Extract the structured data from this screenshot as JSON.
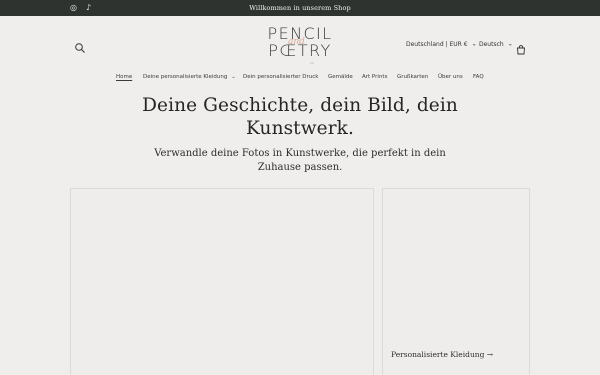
{
  "announcement": {
    "text": "Willkommen in unserem Shop",
    "social": [
      {
        "name": "instagram",
        "glyph": "◎"
      },
      {
        "name": "tiktok",
        "glyph": "♪"
      }
    ]
  },
  "header": {
    "search_icon": "search-icon",
    "logo": {
      "line1": "PENCIL",
      "line2": "PŒTRY",
      "middle": "and",
      "tagline": "co."
    },
    "country_selector": "Deutschland | EUR €",
    "language_selector": "Deutsch",
    "chevron": "⌄",
    "cart_icon": "cart-icon"
  },
  "nav": {
    "items": [
      {
        "label": "Home"
      },
      {
        "label": "Deine personalisierte Kleidung"
      },
      {
        "label": "Dein personalisierter Druck"
      },
      {
        "label": "Gemälde"
      },
      {
        "label": "Art Prints"
      },
      {
        "label": "Grußkarten"
      },
      {
        "label": "Über uns"
      },
      {
        "label": "FAQ"
      }
    ],
    "dropdown_chevron": "⌄"
  },
  "hero": {
    "title": "Deine Geschichte, dein Bild, dein Kunstwerk.",
    "subtitle": "Verwandle deine Fotos in Kunstwerke, die perfekt in dein Zuhause passen."
  },
  "collections": {
    "card_b_link": "Personalisierte Kleidung →"
  },
  "colors": {
    "background": "#efeeec",
    "announcement_bar": "#2f332f",
    "logo_accent": "#d9a99c"
  }
}
